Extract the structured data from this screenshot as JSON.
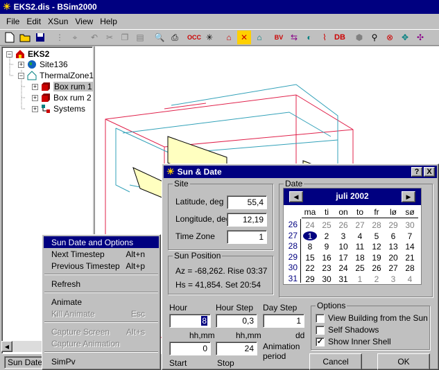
{
  "window": {
    "title": "EKS2.dis - BSim2000"
  },
  "menu": [
    "File",
    "Edit",
    "XSun",
    "View",
    "Help"
  ],
  "tree": {
    "root": "EKS2",
    "site": "Site136",
    "zone": "ThermalZone1",
    "rooms": [
      "Box rum 1",
      "Box rum 2"
    ],
    "systems": "Systems"
  },
  "status": {
    "text": "Sun Date"
  },
  "context_menu": {
    "items": [
      {
        "label": "Sun Date and Options",
        "shortcut": "",
        "state": "selected"
      },
      {
        "label": "Next Timestep",
        "shortcut": "Alt+n",
        "state": "normal"
      },
      {
        "label": "Previous Timestep",
        "shortcut": "Alt+p",
        "state": "normal"
      },
      {
        "label": "Refresh",
        "shortcut": "",
        "state": "normal"
      },
      {
        "label": "Animate",
        "shortcut": "",
        "state": "normal"
      },
      {
        "label": "Kill Animate",
        "shortcut": "Esc",
        "state": "disabled"
      },
      {
        "label": "Capture Screen",
        "shortcut": "Alt+s",
        "state": "disabled"
      },
      {
        "label": "Capture Animation",
        "shortcut": "",
        "state": "disabled"
      },
      {
        "label": "SimPv",
        "shortcut": "",
        "state": "normal"
      }
    ]
  },
  "dialog": {
    "title": "Sun & Date",
    "help": "?",
    "close": "X",
    "site": {
      "label": "Site",
      "latitude_label": "Latitude, deg",
      "latitude": "55,4",
      "longitude_label": "Longitude, deg",
      "longitude": "12,19",
      "timezone_label": "Time Zone",
      "timezone": "1"
    },
    "sun_position": {
      "label": "Sun Position",
      "az": "Az = -68,262. Rise 03:37",
      "hs": "Hs = 41,854. Set 20:54"
    },
    "date": {
      "label": "Date",
      "month": "juli 2002",
      "weekdays": [
        "ma",
        "ti",
        "on",
        "to",
        "fr",
        "lø",
        "sø"
      ],
      "weeks": [
        "26",
        "27",
        "28",
        "29",
        "30",
        "31"
      ],
      "days": [
        [
          "24",
          "25",
          "26",
          "27",
          "28",
          "29",
          "30"
        ],
        [
          "1",
          "2",
          "3",
          "4",
          "5",
          "6",
          "7"
        ],
        [
          "8",
          "9",
          "10",
          "11",
          "12",
          "13",
          "14"
        ],
        [
          "15",
          "16",
          "17",
          "18",
          "19",
          "20",
          "21"
        ],
        [
          "22",
          "23",
          "24",
          "25",
          "26",
          "27",
          "28"
        ],
        [
          "29",
          "30",
          "31",
          "1",
          "2",
          "3",
          "4"
        ]
      ],
      "selected_day": "1"
    },
    "time": {
      "hour_label": "Hour",
      "hour": "8",
      "hourstep_label": "Hour Step",
      "hourstep": "0,3",
      "daystep_label": "Day Step",
      "daystep": "1",
      "hhmm1": "hh,mm",
      "hhmm2": "hh,mm",
      "dd": "dd",
      "start": "0",
      "stop": "24",
      "start_label": "Start",
      "stop_label": "Stop",
      "anim_label1": "Animation",
      "anim_label2": "period"
    },
    "options": {
      "label": "Options",
      "view_from_sun": "View Building from the Sun",
      "view_from_sun_checked": false,
      "self_shadows": "Self Shadows",
      "self_shadows_checked": false,
      "inner_shell": "Show Inner Shell",
      "inner_shell_checked": true
    },
    "cancel": "Cancel",
    "ok": "OK"
  },
  "colors": {
    "titlebar": "#000080",
    "face": "#c0c0c0",
    "wire_red": "#e0204a",
    "wire_cyan": "#30a0b8",
    "shade_yellow": "#ffffc0"
  }
}
